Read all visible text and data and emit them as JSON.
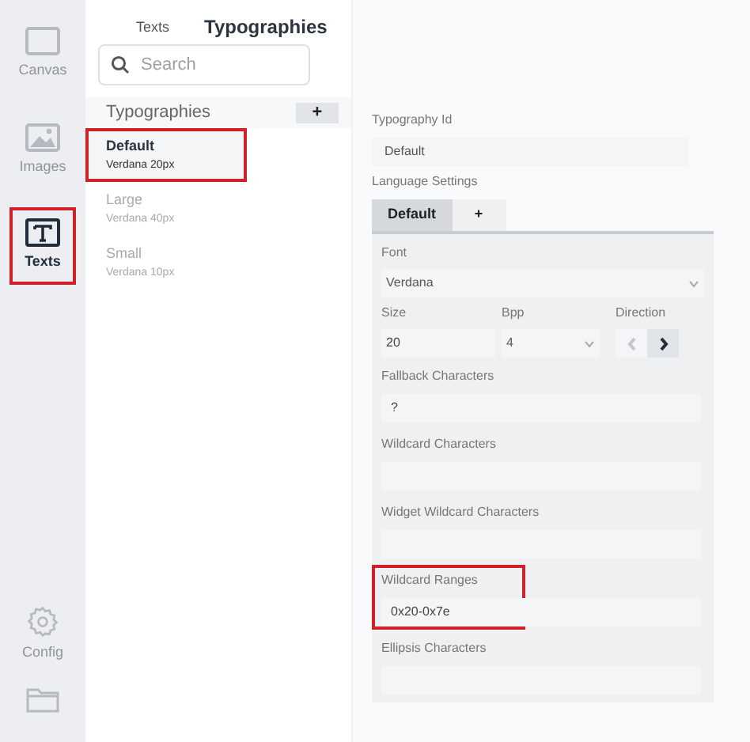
{
  "sidebar": {
    "items": [
      {
        "kind": "canvas",
        "label": "Canvas",
        "selected": false,
        "highlighted": false
      },
      {
        "kind": "images",
        "label": "Images",
        "selected": false,
        "highlighted": false
      },
      {
        "kind": "texts",
        "label": "Texts",
        "selected": true,
        "highlighted": true
      }
    ],
    "bottom_items": [
      {
        "kind": "config",
        "label": "Config"
      },
      {
        "kind": "folder"
      }
    ]
  },
  "tabs": [
    {
      "label": "Texts",
      "selected": false
    },
    {
      "label": "Typographies",
      "selected": true
    }
  ],
  "search": {
    "placeholder": "Search"
  },
  "list": {
    "title": "Typographies",
    "add_button": "+",
    "items": [
      {
        "name": "Default",
        "detail": "Verdana  20px",
        "selected": true,
        "highlighted": true
      },
      {
        "name": "Large",
        "detail": "Verdana  40px",
        "selected": false,
        "highlighted": false
      },
      {
        "name": "Small",
        "detail": "Verdana  10px",
        "selected": false,
        "highlighted": false
      }
    ]
  },
  "details": {
    "id_label": "Typography Id",
    "id_value": "Default",
    "language_label": "Language Settings",
    "language_tabs": [
      {
        "label": "Default",
        "selected": true
      },
      {
        "label": "+",
        "selected": false
      }
    ],
    "font_label": "Font",
    "font_value": "Verdana",
    "size_label": "Size",
    "size_value": "20",
    "bpp_label": "Bpp",
    "bpp_value": "4",
    "direction_label": "Direction",
    "direction_options": [
      {
        "kind": "left",
        "selected": false
      },
      {
        "kind": "right",
        "selected": true
      }
    ],
    "fields": [
      {
        "label": "Fallback Characters",
        "value": "?",
        "highlighted": false
      },
      {
        "label": "Wildcard Characters",
        "highlighted": false
      },
      {
        "label": "Widget Wildcard Characters",
        "highlighted": false
      },
      {
        "label": "Wildcard Ranges",
        "value": "0x20-0x7e",
        "highlighted": true
      },
      {
        "label": "Ellipsis Characters",
        "highlighted": false
      }
    ]
  }
}
